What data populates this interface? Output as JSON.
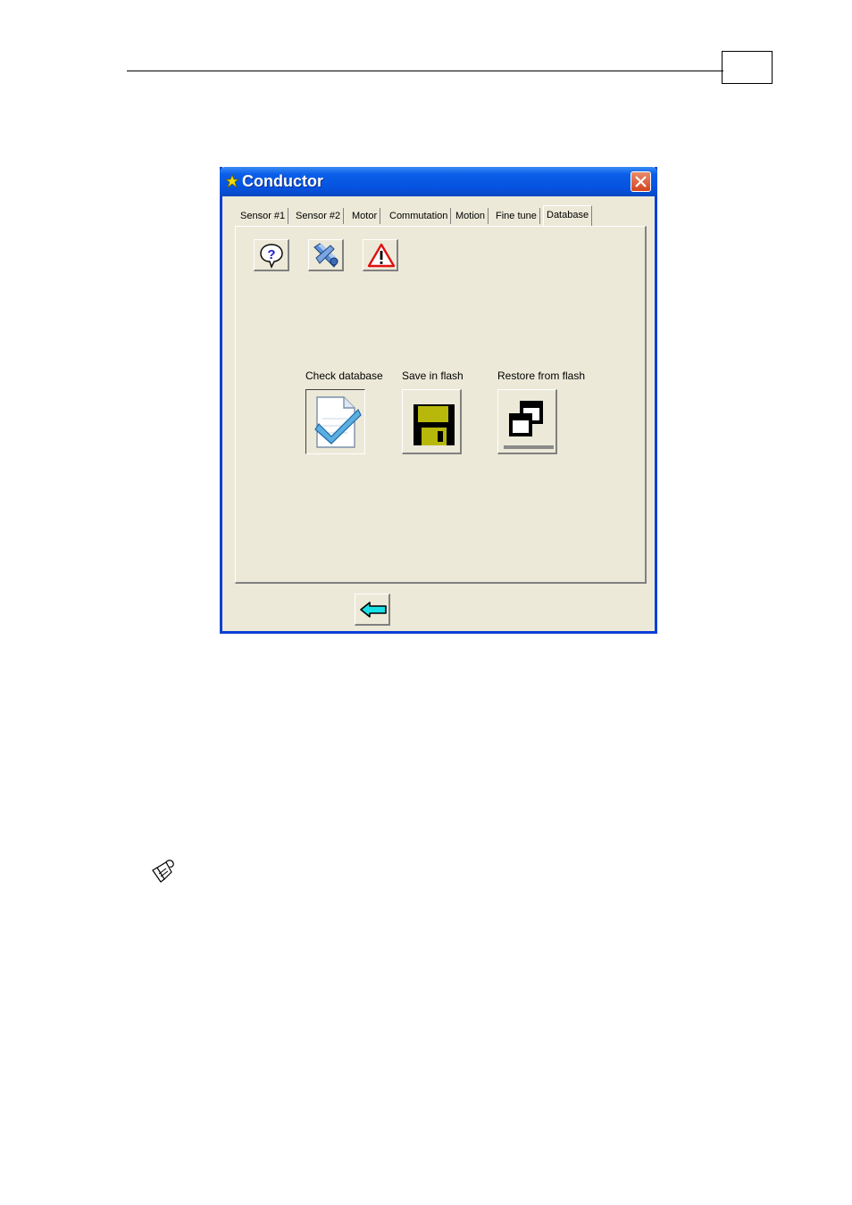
{
  "window": {
    "title": "Conductor",
    "accent_color": "#0a5ee8",
    "close_icon": "close-icon"
  },
  "tabs": [
    {
      "label": "Sensor #1",
      "active": false
    },
    {
      "label": "Sensor #2",
      "active": false
    },
    {
      "label": "Motor",
      "active": false
    },
    {
      "label": "Commutation",
      "active": false
    },
    {
      "label": "Motion",
      "active": false
    },
    {
      "label": "Fine tune",
      "active": false
    },
    {
      "label": "Database",
      "active": true
    }
  ],
  "toolbar": {
    "help_icon": "help-icon",
    "tools_icon": "tools-icon",
    "warning_icon": "warning-icon"
  },
  "actions": {
    "check_label": "Check database",
    "save_label": "Save in flash",
    "restore_label": "Restore from flash"
  },
  "footer": {
    "back_icon": "back-arrow-icon"
  },
  "page": {
    "note_icon": "note-icon"
  }
}
